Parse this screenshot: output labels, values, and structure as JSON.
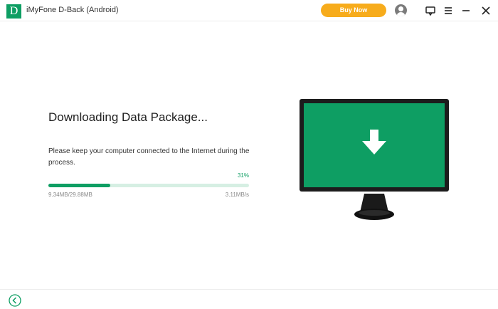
{
  "titlebar": {
    "logo_letter": "D",
    "app_title": "iMyFone D-Back (Android)",
    "buy_now_label": "Buy Now",
    "icons": [
      "account-icon",
      "feedback-icon",
      "menu-icon",
      "minimize-icon",
      "close-icon"
    ]
  },
  "main": {
    "heading": "Downloading Data Package...",
    "description": "Please keep your computer connected to the Internet during the process.",
    "progress": {
      "percent_label": "31%",
      "fraction": 0.31,
      "size_text": "9.34MB/29.88MB",
      "speed_text": "3.11MB/s"
    }
  },
  "illustration": {
    "name": "monitor-download-illustration",
    "icon": "download-arrow-icon"
  },
  "footer": {
    "back_icon": "back-icon"
  },
  "colors": {
    "accent": "#0e9e63",
    "buy_now": "#f7ac1c",
    "progress_track": "#d6efe3"
  }
}
